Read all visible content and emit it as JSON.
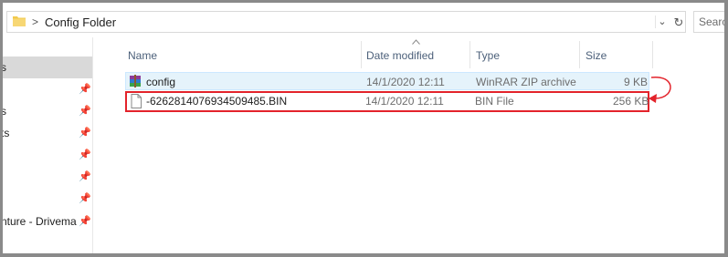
{
  "address": {
    "separator": ">",
    "path": "Config Folder",
    "chevron": "⌄",
    "refresh": "↻"
  },
  "search": {
    "placeholder": "Search"
  },
  "nav": {
    "items": [
      {
        "label": "s",
        "pinned": false,
        "selected": true
      },
      {
        "label": "",
        "pinned": true
      },
      {
        "label": "s",
        "pinned": true
      },
      {
        "label": "ts",
        "pinned": true
      },
      {
        "label": "",
        "pinned": true
      },
      {
        "label": "",
        "pinned": true
      },
      {
        "label": "",
        "pinned": true
      },
      {
        "label": "nture - Drivema",
        "pinned": true
      }
    ]
  },
  "columns": {
    "name": "Name",
    "date": "Date modified",
    "type": "Type",
    "size": "Size"
  },
  "files": [
    {
      "name": "config",
      "date": "14/1/2020 12:11",
      "type": "WinRAR ZIP archive",
      "size": "9 KB",
      "icon": "winrar-archive-icon"
    },
    {
      "name": "-6262814076934509485.BIN",
      "date": "14/1/2020 12:11",
      "type": "BIN File",
      "size": "256 KB",
      "icon": "blank-file-icon"
    }
  ],
  "colors": {
    "highlight_border": "#e3232b",
    "selection_bg": "#e5f3fb",
    "header_text": "#4c607a"
  }
}
